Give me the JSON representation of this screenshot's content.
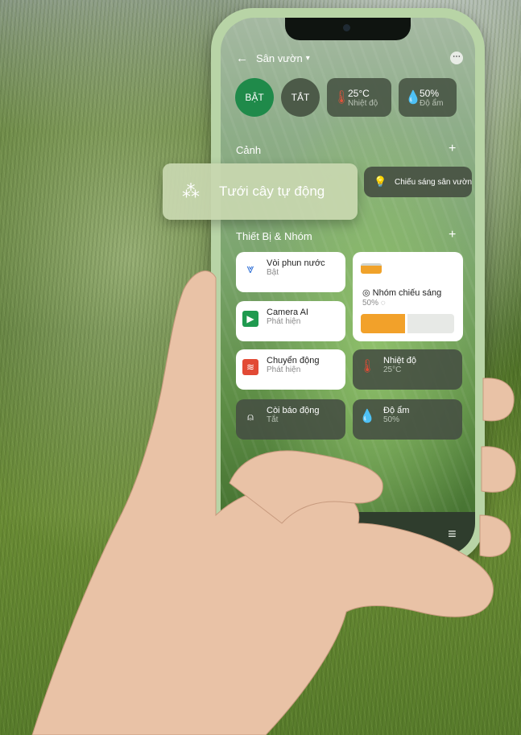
{
  "topbar": {
    "back_icon": "←",
    "title": "Sân vườn",
    "dropdown_icon": "▾",
    "more_icon": "⋯"
  },
  "quick": {
    "on_label": "BẬT",
    "off_label": "TẮT",
    "temp": {
      "value": "25°C",
      "label": "Nhiệt độ"
    },
    "humidity": {
      "value": "50%",
      "label": "Độ ẩm"
    }
  },
  "sections": {
    "scenes": "Cảnh",
    "devices": "Thiết Bị & Nhóm",
    "add_icon": "+"
  },
  "scenes": {
    "auto_watering": "Tưới cây tự động",
    "garden_light": "Chiếu sáng sân vườn"
  },
  "devices": [
    {
      "name": "Vòi phun nước",
      "status": "Bật"
    },
    {
      "name": "Camera AI",
      "status": "Phát hiện"
    },
    {
      "name": "Chuyển động",
      "status": "Phát hiện"
    },
    {
      "name": "Nhiệt độ",
      "status": "25°C"
    },
    {
      "name": "Còi báo động",
      "status": "Tắt"
    },
    {
      "name": "Độ ẩm",
      "status": "50%"
    }
  ],
  "light_group": {
    "name": "Nhóm chiếu sáng",
    "value": "50%",
    "level": 0.5
  },
  "colors": {
    "accent": "#1f8a4a",
    "nav_active": "#3cc56a",
    "slider": "#f2a12a"
  },
  "nav": {
    "items": [
      "home-icon",
      "clock-icon",
      "headphones-icon",
      "menu-icon"
    ]
  }
}
